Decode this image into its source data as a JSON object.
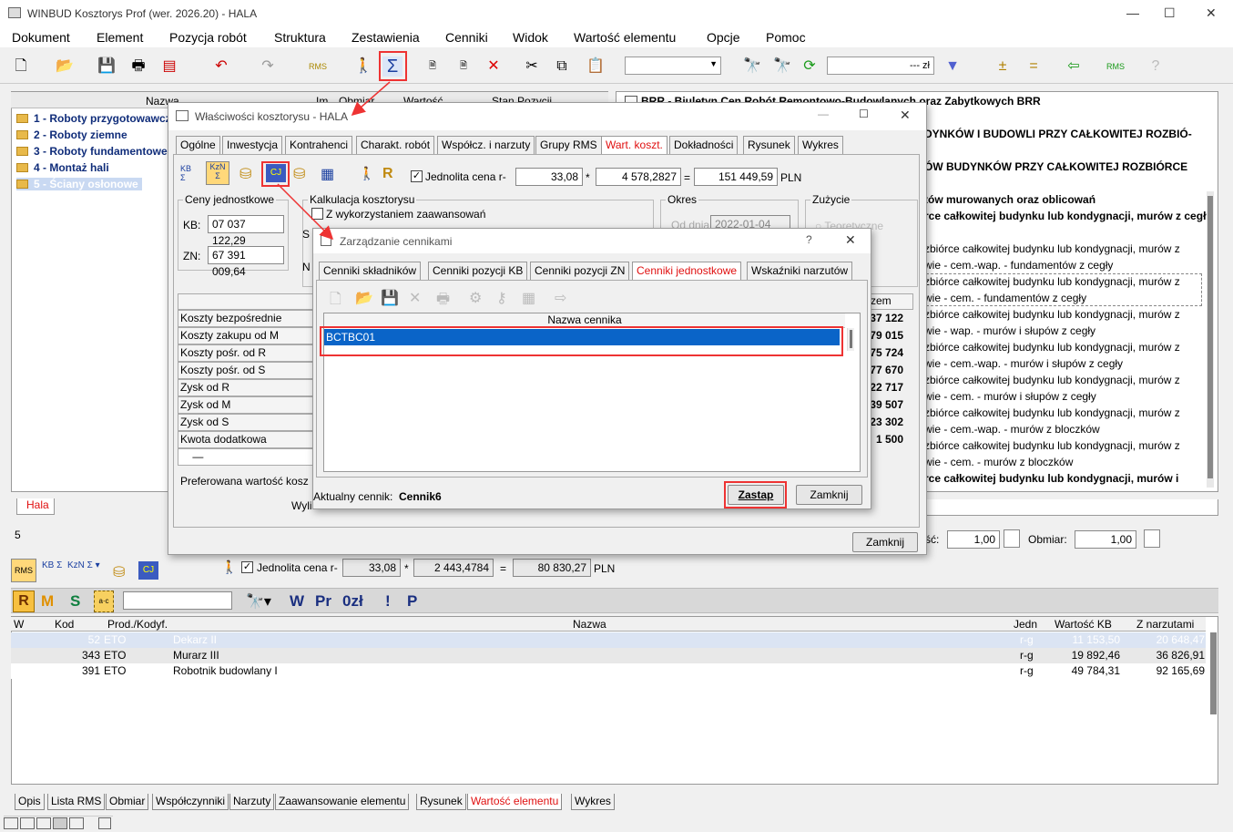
{
  "app": {
    "title": "WINBUD Kosztorys Prof (wer. 2026.20) - HALA"
  },
  "menu": [
    "Dokument",
    "Element",
    "Pozycja robót",
    "Struktura",
    "Zestawienia",
    "Cenniki",
    "Widok",
    "Wartość elementu",
    "Opcje",
    "Pomoc"
  ],
  "toolbar": {
    "price_placeholder": "--- zł"
  },
  "left_tree": {
    "headers": [
      "Nazwa",
      "Im",
      "Obmiar",
      "Wartość",
      "Stan Pozycji"
    ],
    "items": [
      "1 - Roboty przygotowawcz",
      "2 - Roboty ziemne",
      "3 - Roboty fundamentowe",
      "4 - Montaż hali",
      "5 - Ściany osłonowe"
    ],
    "tab": "Hala",
    "count": "5"
  },
  "right_panel": {
    "lines": [
      "BRR - Biuletyn Cen Robót Remontowo-Budowlanych oraz Zabytkowych BRR",
      "DYNKÓW I BUDOWLI PRZY CAŁKOWITEJ ROZBIÓ-",
      "ÓW BUDYNKÓW PRZY CAŁKOWITEJ ROZBIÓRCE",
      "tów murowanych oraz oblicowań",
      "rce całkowitej budynku lub kondygnacji, murów z cegły",
      "zbiórce całkowitej budynku lub kondygnacji, murów z",
      "wie - cem.-wap. - fundamentów z cegły",
      "zbiórce całkowitej budynku lub kondygnacji, murów z",
      "wie - cem. - fundamentów z cegły",
      "zbiórce całkowitej budynku lub kondygnacji, murów z",
      "wie - wap. - murów i słupów z cegły",
      "zbiórce całkowitej budynku lub kondygnacji, murów z",
      "wie - cem.-wap. - murów i słupów z cegły",
      "zbiórce całkowitej budynku lub kondygnacji, murów z",
      "wie - cem. - murów i słupów z cegły",
      "zbiórce całkowitej budynku lub kondygnacji, murów z",
      "wie - cem.-wap. - murów z bloczków",
      "zbiórce całkowitej budynku lub kondygnacji, murów z",
      "wie - cem. - murów z bloczków",
      "rce całkowitej budynku lub kondygnacji, murów i"
    ],
    "ilosc": "1,00",
    "obmiar_label": "Obmiar:",
    "obmiar": "1,00"
  },
  "props_dialog": {
    "title": "Właściwości kosztorysu - HALA",
    "tabs": [
      "Ogólne",
      "Inwestycja",
      "Kontrahenci",
      "Charakt. robót",
      "Współcz. i narzuty",
      "Grupy RMS",
      "Wart. koszt.",
      "Dokładności",
      "Rysunek",
      "Wykres"
    ],
    "checkbox_label": "Jednolita cena r-",
    "rate": "33,08",
    "hours": "4 578,2827",
    "total": "151 449,59",
    "currency": "PLN",
    "ceny_label": "Ceny jednostkowe",
    "kb_label": "KB:",
    "kb_value": "07 037 122,29",
    "zn_label": "ZN:",
    "zn_value": "67 391 009,64",
    "kalk_label": "Kalkulacja kosztorysu",
    "kalk_check": "Z wykorzystaniem zaawansowań",
    "okres_label": "Okres",
    "od_dnia": "Od dnia",
    "date": "2022-01-04",
    "zuzycie_label": "Zużycie",
    "teoret": "Teoretyczne",
    "cost_rows": [
      "Koszty bezpośrednie",
      "Koszty zakupu od M",
      "Koszty pośr. od R",
      "Koszty pośr. od S",
      "Zysk od R",
      "Zysk od M",
      "Zysk od S",
      "Kwota dodatkowa"
    ],
    "col_header": "zem",
    "col_values": [
      "37 122",
      "79 015",
      "75 724",
      "77 670",
      "22 717",
      "39 507",
      "23 302",
      "1 500"
    ],
    "preferowana": "Preferowana wartość kosz",
    "wyli": "Wyli",
    "close": "Zamknij"
  },
  "cenniki_dialog": {
    "title": "Zarządzanie cennikami",
    "help": "?",
    "tabs": [
      "Cenniki składników",
      "Cenniki pozycji KB",
      "Cenniki pozycji ZN",
      "Cenniki jednostkowe",
      "Wskaźniki narzutów"
    ],
    "col_header": "Nazwa cennika",
    "rows": [
      "BCTBC01"
    ],
    "current_label": "Aktualny cennik:",
    "current_value": "Cennik6",
    "replace_button": "Zastap",
    "close_button": "Zamknij"
  },
  "lower": {
    "checkbox_label": "Jednolita cena r-",
    "rate": "33,08",
    "hours": "2 443,4784",
    "total": "80 830,27",
    "currency": "PLN",
    "letters": [
      "R",
      "M",
      "S"
    ],
    "wtools": [
      "W",
      "Pr",
      "0zł",
      "!",
      "P"
    ],
    "headers": [
      "W",
      "Kod",
      "Prod./Kodyf.",
      "Nazwa",
      "Jedn",
      "Wartość KB",
      "Z narzutami"
    ],
    "rows": [
      {
        "kod": "52",
        "prod": "ETO",
        "nazwa": "Dekarz II",
        "jedn": "r-g",
        "kb": "11 153,50",
        "zn": "20 648,47"
      },
      {
        "kod": "343",
        "prod": "ETO",
        "nazwa": "Murarz III",
        "jedn": "r-g",
        "kb": "19 892,46",
        "zn": "36 826,91"
      },
      {
        "kod": "391",
        "prod": "ETO",
        "nazwa": "Robotnik budowlany I",
        "jedn": "r-g",
        "kb": "49 784,31",
        "zn": "92 165,69"
      }
    ],
    "tabs": [
      "Opis",
      "Lista RMS",
      "Obmiar",
      "Współczynniki",
      "Narzuty",
      "Zaawansowanie elementu",
      "Rysunek",
      "Wartość elementu",
      "Wykres"
    ]
  },
  "colors": {
    "accent_red": "#e33333",
    "selection": "#0a64c8",
    "tree_text": "#102d7a"
  }
}
